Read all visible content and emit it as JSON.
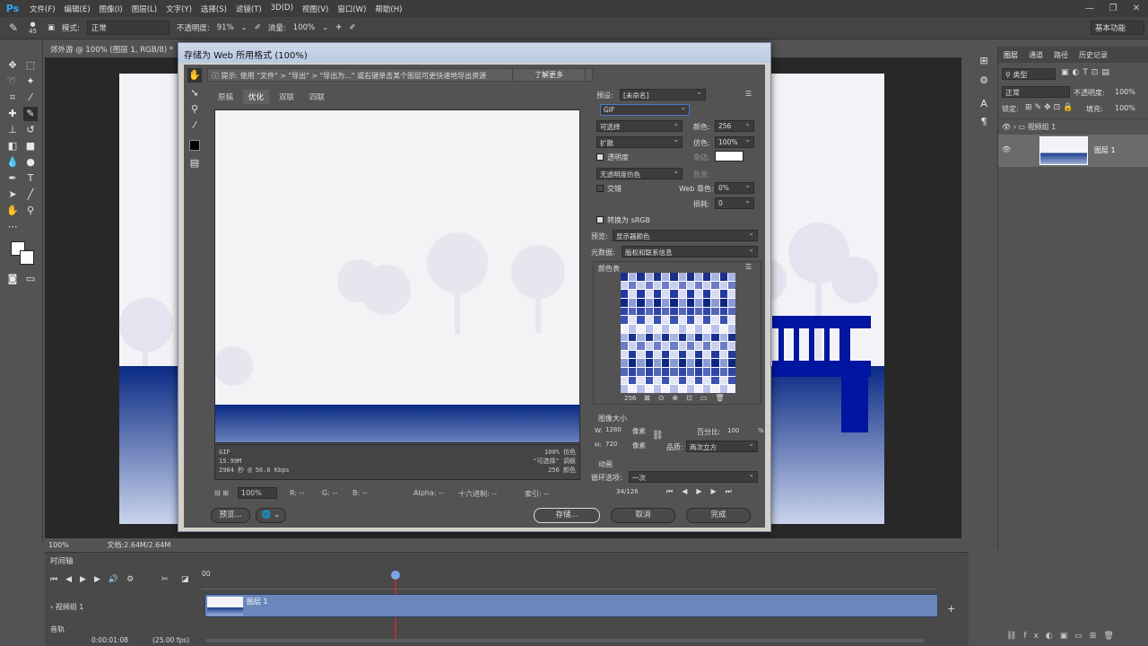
{
  "app": {
    "logo": "Ps"
  },
  "menu": [
    "文件(F)",
    "编辑(E)",
    "图像(I)",
    "图层(L)",
    "文字(Y)",
    "选择(S)",
    "滤镜(T)",
    "3D(D)",
    "视图(V)",
    "窗口(W)",
    "帮助(H)"
  ],
  "options": {
    "brush_size": "45",
    "mode_label": "模式:",
    "mode_value": "正常",
    "opacity_label": "不透明度:",
    "opacity_value": "91%",
    "flow_label": "流量:",
    "flow_value": "100%",
    "workspace": "基本功能"
  },
  "document": {
    "tab_title": "郊外游 @ 100% (图层 1, RGB/8) *",
    "zoom": "100%",
    "doc_size": "文档:2.64M/2.64M"
  },
  "layers_panel": {
    "tabs": [
      "图层",
      "通道",
      "路径",
      "历史记录"
    ],
    "filter_type": "类型",
    "blend_mode": "正常",
    "opacity_label": "不透明度:",
    "opacity_value": "100%",
    "lock_label": "锁定:",
    "fill_label": "填充:",
    "fill_value": "100%",
    "group_name": "视频组 1",
    "layer_name": "图层 1"
  },
  "timeline": {
    "title": "时间轴",
    "start_label": "00",
    "track_name": "视频组 1",
    "clip_name": "图层 1",
    "audio_track": "音轨",
    "time": "0:00:01:08",
    "fps": "(25.00 fps)"
  },
  "dialog": {
    "title": "存储为 Web 所用格式 (100%)",
    "hint": "提示: 使用 \"文件\" > \"导出\" > \"导出为...\" 或右键单击某个图层可更快速地导出资源",
    "learn_more": "了解更多",
    "tabs": [
      "原稿",
      "优化",
      "双联",
      "四联"
    ],
    "preview_info": {
      "format": "GIF",
      "size": "15.99M",
      "time": "2984 秒 @ 56.6 Kbps",
      "dither": "100% 仿色",
      "palette": "\"可选择\" 调板",
      "colors": "256 颜色"
    },
    "zoom": "100%",
    "r_label": "R: --",
    "g_label": "G: --",
    "b_label": "B: --",
    "alpha_label": "Alpha: --",
    "hex_label": "十六进制: --",
    "index_label": "索引: --",
    "preview_btn": "预览...",
    "save_btn": "存储...",
    "cancel_btn": "取消",
    "done_btn": "完成",
    "settings": {
      "preset_label": "预设:",
      "preset_value": "[未命名]",
      "format": "GIF",
      "reduction": "可选择",
      "colors_label": "颜色:",
      "colors_value": "256",
      "dither_algo": "扩散",
      "dither_label": "仿色:",
      "dither_value": "100%",
      "transparency": "透明度",
      "matte_label": "杂边:",
      "trans_dither": "无透明度仿色",
      "amount_label": "数量:",
      "interlaced": "交错",
      "web_snap_label": "Web 靠色:",
      "web_snap_value": "0%",
      "lossy_label": "损耗:",
      "lossy_value": "0",
      "convert_srgb": "转换为 sRGB",
      "preview_label": "预览:",
      "preview_value": "显示器颜色",
      "metadata_label": "元数据:",
      "metadata_value": "版权和联系信息",
      "color_table_title": "颜色表",
      "color_count": "256",
      "image_size_title": "图像大小",
      "w_label": "W:",
      "w_value": "1280",
      "h_label": "H:",
      "h_value": "720",
      "unit": "像素",
      "percent_label": "百分比:",
      "percent_value": "100",
      "percent_unit": "%",
      "quality_label": "品质:",
      "quality_value": "两次立方",
      "animation_title": "动画",
      "loop_label": "循环选项:",
      "loop_value": "一次",
      "frame_counter": "34/126"
    }
  },
  "colors": {
    "accent": "#31a8ff",
    "deep_blue": "#0a2d8c",
    "dialog_title": "#c6d3e8"
  }
}
